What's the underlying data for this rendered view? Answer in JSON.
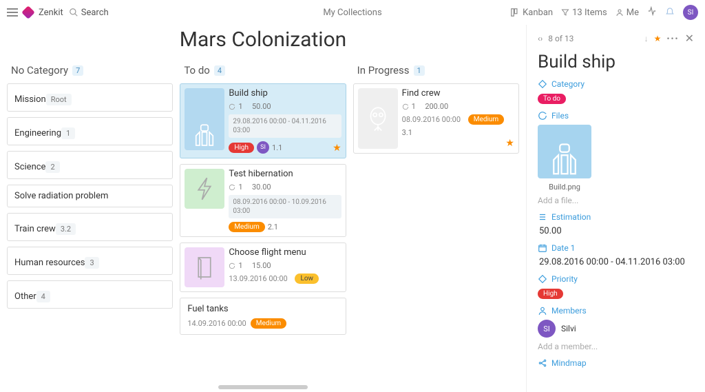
{
  "header": {
    "brand": "Zenkit",
    "search": "Search",
    "breadcrumb": "My Collections",
    "view": "Kanban",
    "items": "13 Items",
    "me": "Me",
    "avatar": "SI"
  },
  "page_title": "Mars Colonization",
  "columns": [
    {
      "title": "No Category",
      "count": "7",
      "cards": [
        {
          "type": "simple",
          "title": "Mission",
          "meta": "Root"
        },
        {
          "type": "simple",
          "title": "Engineering",
          "meta": "1"
        },
        {
          "type": "simple",
          "title": "Science",
          "meta": "2"
        },
        {
          "type": "simple",
          "title": "Solve radiation problem",
          "meta": ""
        },
        {
          "type": "simple",
          "title": "Train crew",
          "meta": "3.2"
        },
        {
          "type": "simple",
          "title": "Human resources",
          "meta": "3"
        },
        {
          "type": "simple",
          "title": "Other",
          "meta": "4"
        }
      ]
    },
    {
      "title": "To do",
      "count": "4",
      "cards": [
        {
          "type": "rich",
          "selected": true,
          "thumb": "rockets",
          "color": "blue",
          "title": "Build ship",
          "attach": "1",
          "est": "50.00",
          "date": "29.08.2016 00:00 - 04.11.2016 03:00",
          "priority": "High",
          "avatar": "SI",
          "code": "1.1",
          "star": true
        },
        {
          "type": "rich",
          "thumb": "bolt",
          "color": "green",
          "title": "Test hibernation",
          "attach": "1",
          "est": "30.00",
          "date": "08.09.2016 00:00 - 10.09.2016 03:00",
          "priority": "Medium",
          "code": "2.1"
        },
        {
          "type": "rich",
          "thumb": "book",
          "color": "purple",
          "title": "Choose flight menu",
          "attach": "1",
          "est": "15.00",
          "date_simple": "13.09.2016 00:00",
          "priority": "Low"
        },
        {
          "type": "simple2",
          "title": "Fuel tanks",
          "date_simple": "14.09.2016 00:00",
          "priority": "Medium"
        }
      ]
    },
    {
      "title": "In Progress",
      "count": "1",
      "cards": [
        {
          "type": "rich",
          "thumb": "alien",
          "color": "gray",
          "title": "Find crew",
          "attach": "1",
          "est": "200.00",
          "date_simple": "08.09.2016 00:00",
          "priority": "Medium",
          "code": "3.1",
          "star": true
        }
      ]
    }
  ],
  "detail": {
    "nav": "8 of 13",
    "title": "Build ship",
    "category": {
      "label": "Category",
      "value": "To do"
    },
    "files": {
      "label": "Files",
      "file": "Build.png",
      "add": "Add a file..."
    },
    "estimation": {
      "label": "Estimation",
      "value": "50.00"
    },
    "date1": {
      "label": "Date 1",
      "value": "29.08.2016 00:00 - 04.11.2016 03:00"
    },
    "priority": {
      "label": "Priority",
      "value": "High"
    },
    "members": {
      "label": "Members",
      "name": "Silvi",
      "avatar": "SI",
      "add": "Add a member..."
    },
    "mindmap": {
      "label": "Mindmap"
    }
  }
}
